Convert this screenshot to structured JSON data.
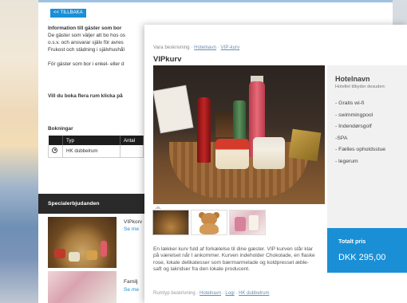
{
  "background": {
    "back_button": "<< TILLBAKA",
    "info_lines": [
      {
        "text": "Information till gäster som bor",
        "bold": true
      },
      {
        "text": "De gäster som väljer att bo hos os",
        "bold": false
      },
      {
        "text": "o.s.v. och ansvarar själv för avres",
        "bold": false
      },
      {
        "text": "Frukost och städning i självhushål",
        "bold": false
      },
      {
        "text": "",
        "bold": false
      },
      {
        "text": "För gäster som bor i enkel- eller d",
        "bold": false
      }
    ],
    "book_more": "Vill du boka flera rum klicka på",
    "bookings_title": "Bokningar",
    "bookings_table": {
      "headers": [
        "",
        "Typ",
        "Antal"
      ],
      "rows": [
        [
          "",
          "HK dubbelrum",
          ""
        ]
      ]
    },
    "offers_title": "Specialerbjudanden",
    "offers": [
      {
        "title": "VIPkorv",
        "link": "Se me"
      },
      {
        "title": "Familj",
        "link": "Se me"
      }
    ]
  },
  "modal": {
    "breadcrumb": {
      "prefix": "Vara beskrivning",
      "links": [
        "Hotelnavn",
        "VIP-kurv"
      ]
    },
    "title": "VIPkurv",
    "description": "En lækker kurv fuld af forkælelse til dine gæster. VIP kurven står klar på værelset når I ankommer. Kurven indeholder Chokolade, en flaske rose, lokale delikatesser som bærmarmelade og koldpresset æble-saft og lakridser fra den lokale producent.",
    "footer_breadcrumb": {
      "prefix": "Rumtyp beskrivning",
      "links": [
        "Hotelnavn",
        "Logi",
        "HK dubbelrum"
      ]
    },
    "hotel": {
      "name": "Hotelnavn",
      "subtitle": "Hotellet tilbyder desuden:",
      "amenities": [
        "- Gratis wi-fi",
        "- swimmingpool",
        "- Indendørsgolf",
        "-SPA",
        "- Fælles opholdsstue",
        "- legerum"
      ]
    },
    "price": {
      "label": "Totalt pris",
      "value": "DKK 295,00"
    }
  },
  "colors": {
    "accent": "#1a8fd6",
    "dark_bar": "#2a2a2a"
  }
}
